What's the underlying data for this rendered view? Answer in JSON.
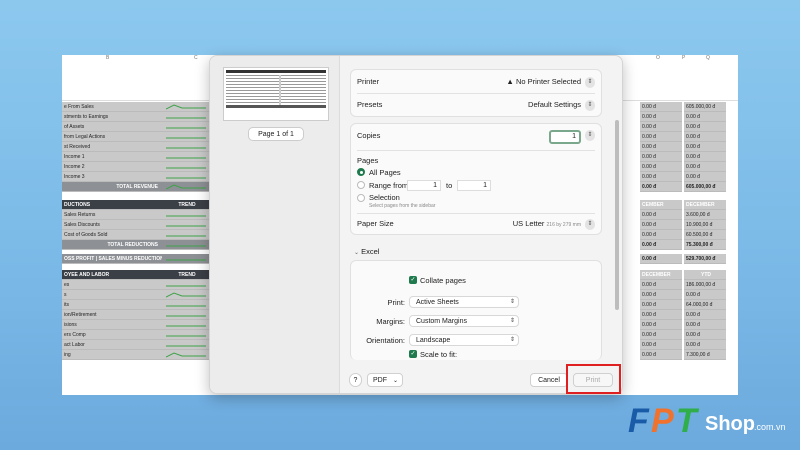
{
  "sheet": {
    "col_labels": [
      "B",
      "C",
      "O",
      "P",
      "Q"
    ],
    "revenue_rows": [
      "e From Sales",
      "stments to Earnings",
      "of Assets",
      "from Legal Actions",
      "st Received",
      "Income 1",
      "Income 2",
      "Income 3"
    ],
    "total_revenue": "TOTAL REVENUE",
    "reductions_header": "DUCTIONS",
    "trend_label": "TREND",
    "reduction_rows": [
      "Sales Returns",
      "Sales Discounts",
      "Cost of Goods Sold"
    ],
    "total_reductions": "TOTAL REDUCTIONS",
    "gross_profit": "OSS PROFIT | SALES MINUS REDUCTIONS",
    "employee_header": "OYEE AND LABOR",
    "employee_rows": [
      "es",
      "s",
      "its",
      "ion/Retirement",
      "isions",
      "ers Comp",
      "act Labor",
      "ing"
    ],
    "right_col1": {
      "revenue": [
        "0.00 đ",
        "0.00 đ",
        "0.00 đ",
        "0.00 đ",
        "0.00 đ",
        "0.00 đ",
        "0.00 đ",
        "0.00 đ"
      ],
      "revenue_total": "0.00 đ",
      "header_dec": "CEMBER",
      "reductions": [
        "0.00 đ",
        "0.00 đ",
        "0.00 đ"
      ],
      "reductions_total": "0.00 đ",
      "gross": "0.00 đ",
      "employee": [
        "0.00 đ",
        "0.00 đ",
        "0.00 đ",
        "0.00 đ",
        "0.00 đ",
        "0.00 đ",
        "0.00 đ",
        "0.00 đ"
      ]
    },
    "right_col2": {
      "revenue": [
        "605.000,00 đ",
        "0.00 đ",
        "0.00 đ",
        "0.00 đ",
        "0.00 đ",
        "0.00 đ",
        "0.00 đ",
        "0.00 đ"
      ],
      "revenue_total": "0.00 đ",
      "header_dec": "DECEMBER",
      "reductions": [
        "0.00 đ",
        "0.00 đ",
        "0.00 đ"
      ],
      "reductions_total": "0.00 đ",
      "gross": "0.00 đ",
      "employee": [
        "0.00 đ",
        "0.00 đ",
        "0.00 đ",
        "0.00 đ",
        "0.00 đ",
        "0.00 đ",
        "0.00 đ",
        "0.00 đ"
      ]
    },
    "right_col3": {
      "revenue": [
        "605.000,00 đ",
        "0.00 đ",
        "0.00 đ",
        "0.00 đ",
        "0.00 đ",
        "0.00 đ",
        "0.00 đ",
        "0.00 đ"
      ],
      "revenue_total": "605.000,00 đ",
      "header": "YTD",
      "reductions": [
        "3.600,00 đ",
        "10.900,00 đ",
        "60.500,00 đ"
      ],
      "reductions_total": "75.300,00 đ",
      "gross": "529.700,00 đ",
      "employee": [
        "186.000,00 đ",
        "0.00 đ",
        "64.000,00 đ",
        "0.00 đ",
        "0.00 đ",
        "0.00 đ",
        "0.00 đ",
        "7.300,00 đ"
      ]
    }
  },
  "dialog": {
    "page_indicator": "Page 1 of 1",
    "printer_label": "Printer",
    "printer_value": "No Printer Selected",
    "presets_label": "Presets",
    "presets_value": "Default Settings",
    "copies_label": "Copies",
    "copies_value": "1",
    "pages_label": "Pages",
    "all_pages": "All Pages",
    "range_from": "Range from",
    "range_start": "1",
    "range_to": "to",
    "range_end": "1",
    "selection": "Selection",
    "selection_hint": "Select pages from the sidebar",
    "paper_label": "Paper Size",
    "paper_value": "US Letter",
    "paper_dims": "216 by 279 mm",
    "excel_section": "Excel",
    "collate": "Collate pages",
    "print_label": "Print:",
    "print_value": "Active Sheets",
    "margins_label": "Margins:",
    "margins_value": "Custom Margins",
    "orientation_label": "Orientation:",
    "orientation_value": "Landscape",
    "scale": "Scale to fit:",
    "help": "?",
    "pdf": "PDF",
    "cancel": "Cancel",
    "print_button": "Print"
  },
  "brand": {
    "logo_text": "FPT",
    "shop_text": "Shop",
    "domain_text": ".com.vn"
  },
  "colors": {
    "accent": "#1f7a4d",
    "highlight_box": "#e02020",
    "brand_blue": "#1a5ba8",
    "brand_orange": "#f0722c",
    "brand_green": "#2fae4a"
  }
}
